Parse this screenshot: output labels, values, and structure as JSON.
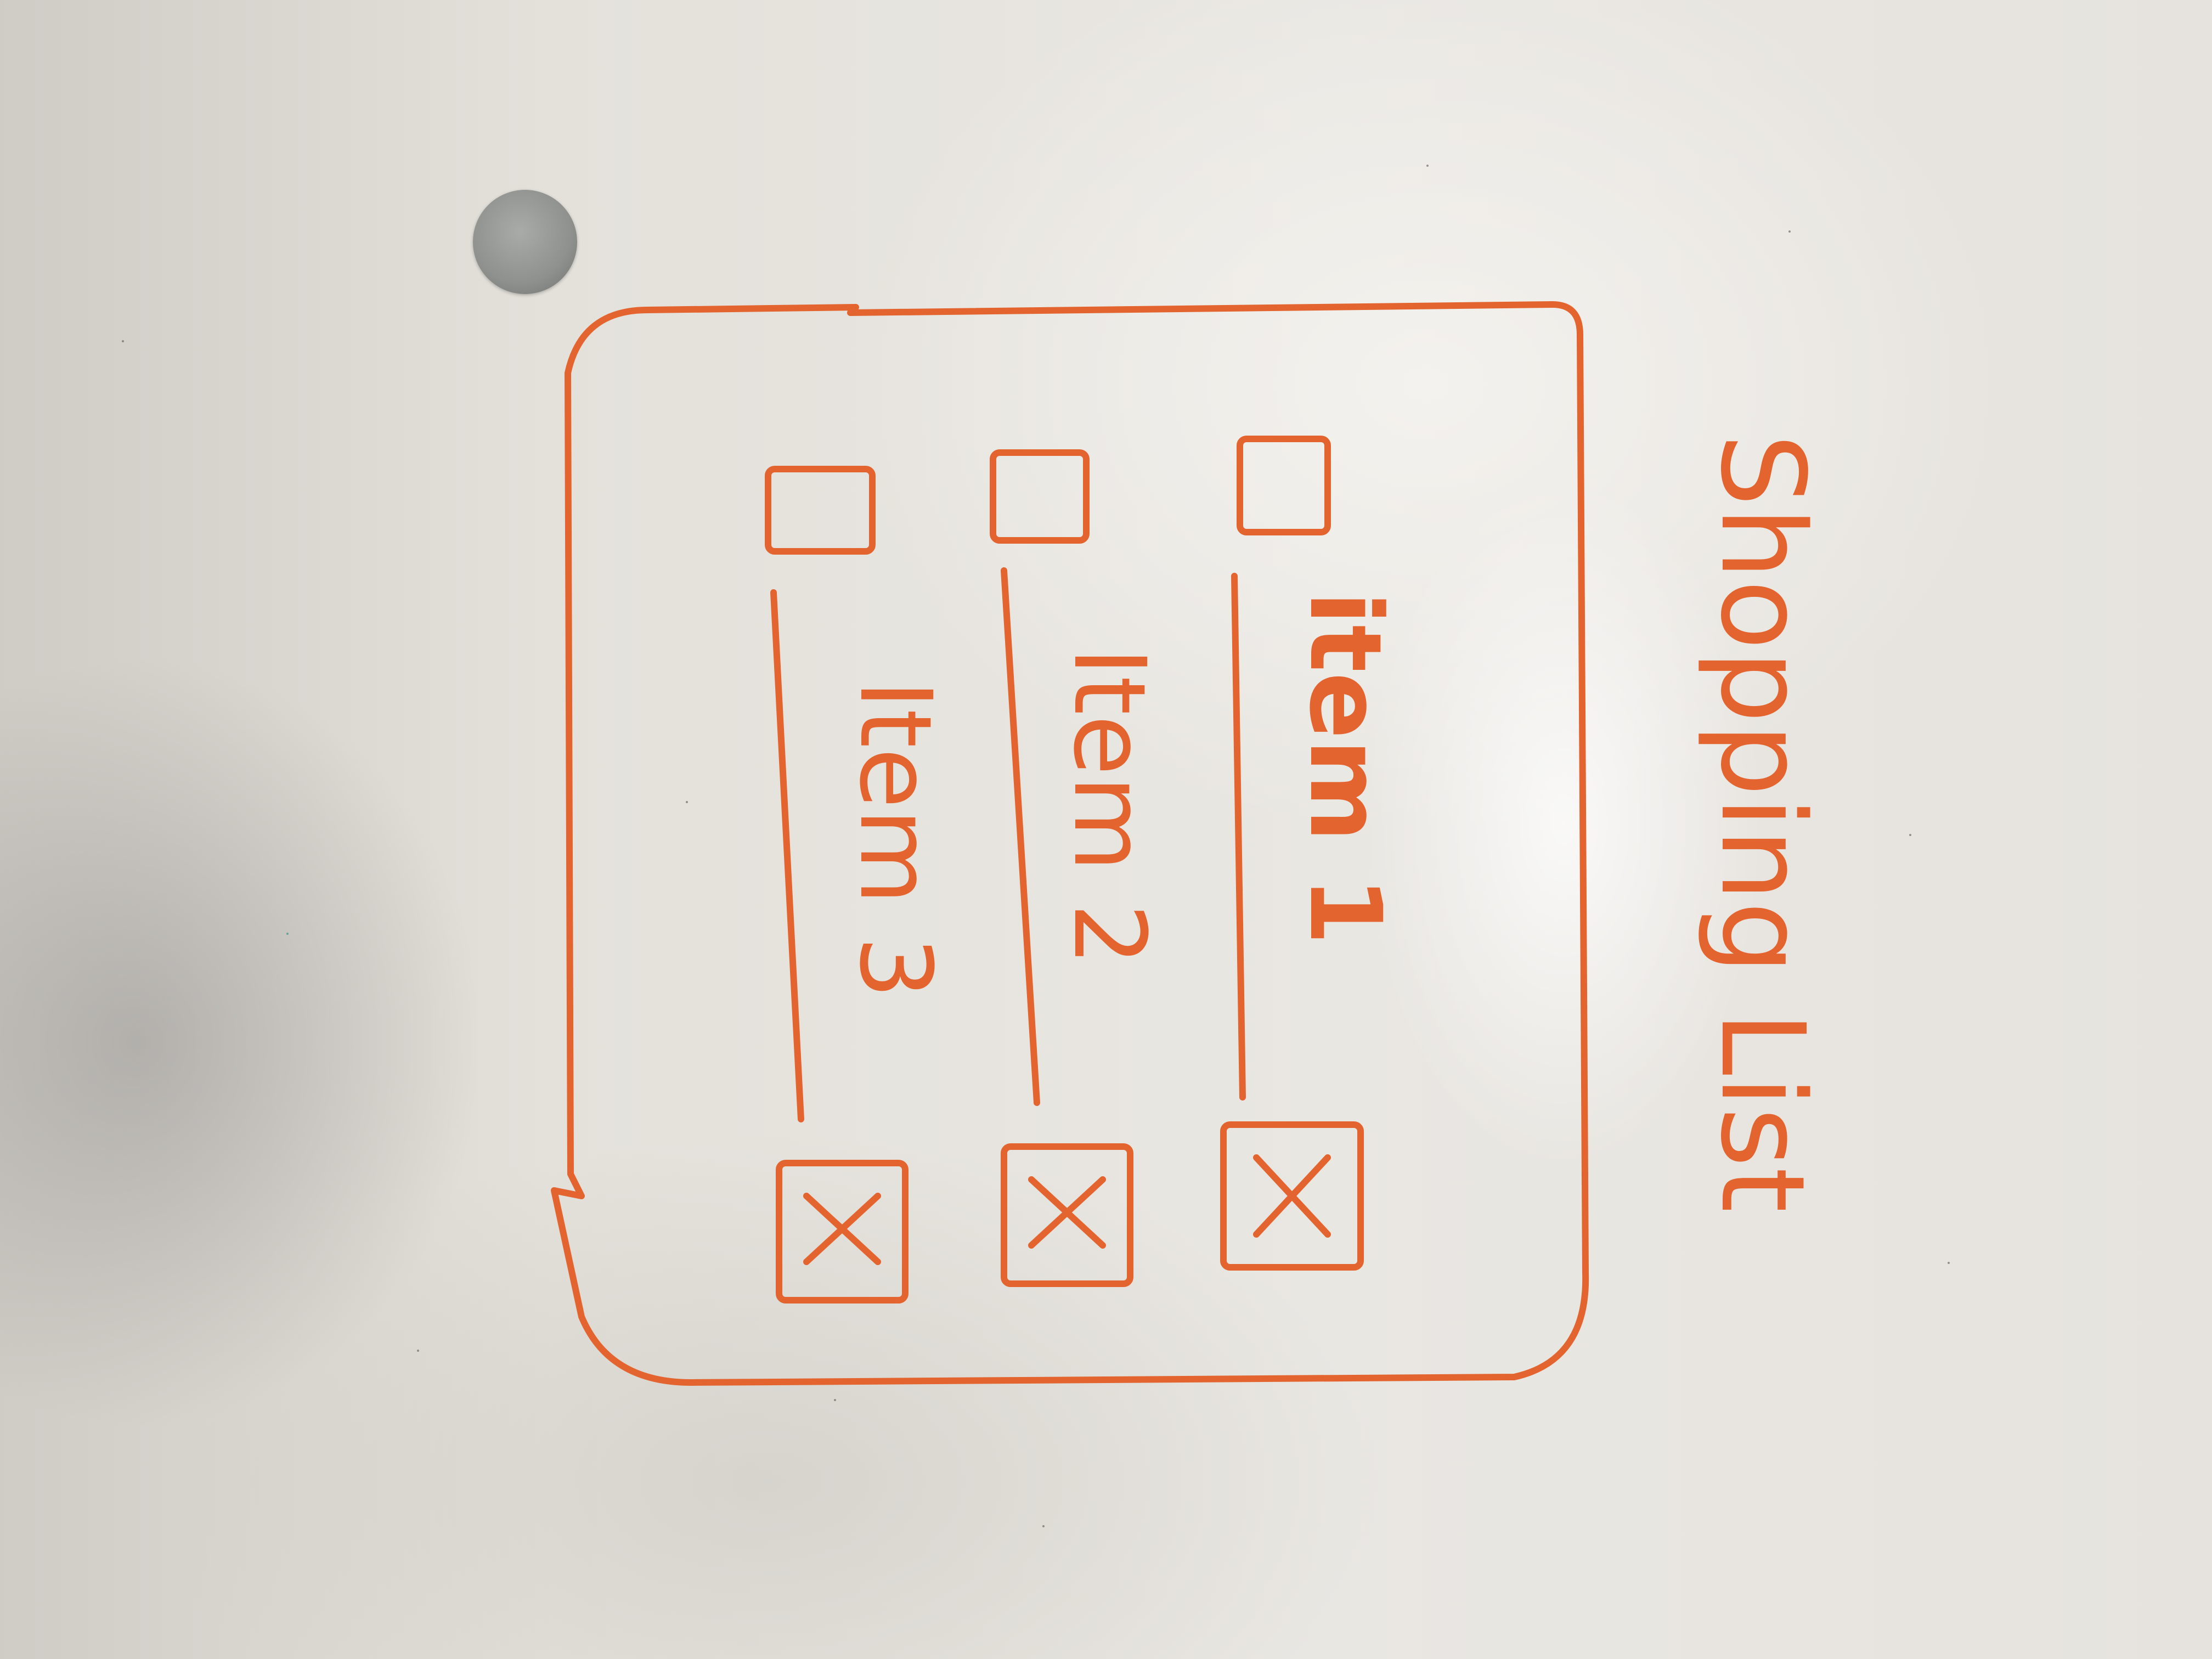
{
  "title": "Shopping List",
  "items": [
    {
      "label": "item 1",
      "checked": true
    },
    {
      "label": "Item 2",
      "checked": true
    },
    {
      "label": "Item 3",
      "checked": true
    }
  ],
  "ink_color": "#e3642e",
  "icons": {
    "check": "x-mark-icon",
    "magnet": "magnet-icon"
  }
}
